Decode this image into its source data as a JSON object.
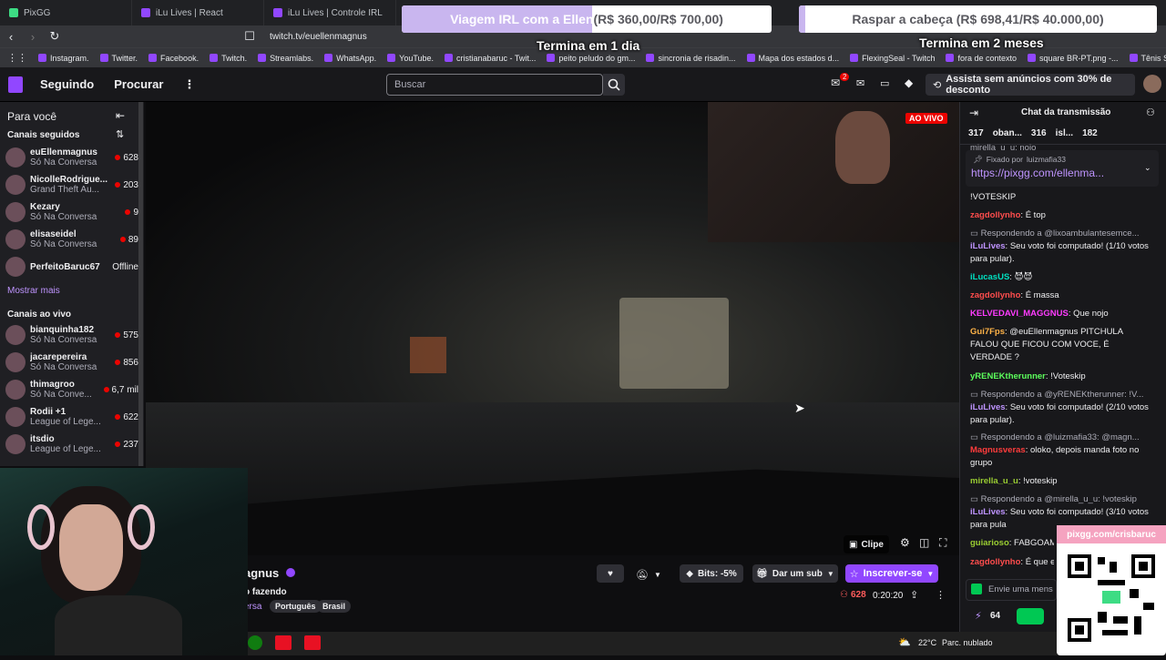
{
  "browser": {
    "tabs": [
      {
        "label": "PixGG"
      },
      {
        "label": "iLu Lives | React"
      },
      {
        "label": "iLu Lives | Controle IRL"
      }
    ],
    "url": "twitch.tv/euellenmagnus",
    "bookmarks": [
      "Instagram.",
      "Twitter.",
      "Facebook.",
      "Twitch.",
      "Streamlabs.",
      "WhatsApp.",
      "YouTube.",
      "cristianabaruc - Twit...",
      "peito peludo do gm...",
      "sincronia de risadin...",
      "Mapa dos estados d...",
      "FlexingSeal - Twitch",
      "fora de contexto",
      "square BR-PT.png -...",
      "Tênis Samba OG -..."
    ]
  },
  "goals": [
    {
      "label_a": "Viagem IRL com a Ellen",
      "label_b": " (R$ 360,00/R$ 700,00)",
      "sub": "Termina em 1 dia",
      "progress": 0.514
    },
    {
      "label": "Raspar a cabeça (R$ 698,41/R$ 40.000,00)",
      "sub": "Termina em 2 meses",
      "progress": 0.017
    }
  ],
  "topnav": {
    "following": "Seguindo",
    "browse": "Procurar",
    "search_placeholder": "Buscar",
    "notif_count": "2",
    "promo": "Assista sem anúncios com 30% de desconto"
  },
  "sidebar": {
    "title": "Para você",
    "followed_header": "Canais seguidos",
    "followed": [
      {
        "name": "euEllenmagnus",
        "game": "Só Na Conversa",
        "viewers": "628"
      },
      {
        "name": "NicolleRodrigue...",
        "game": "Grand Theft Au...",
        "viewers": "203"
      },
      {
        "name": "Kezary",
        "game": "Só Na Conversa",
        "viewers": "9"
      },
      {
        "name": "elisaseidel",
        "game": "Só Na Conversa",
        "viewers": "89"
      },
      {
        "name": "PerfeitoBaruc67",
        "game": "",
        "viewers": "Offline"
      }
    ],
    "show_more": "Mostrar mais",
    "live_header": "Canais ao vivo",
    "live": [
      {
        "name": "bianquinha182",
        "game": "Só Na Conversa",
        "viewers": "575"
      },
      {
        "name": "jacarepereira",
        "game": "Só Na Conversa",
        "viewers": "856"
      },
      {
        "name": "thimagroo",
        "game": "Só Na Conve...",
        "viewers": "6,7 mil"
      },
      {
        "name": "Rodii +1",
        "game": "League of Lege...",
        "viewers": "622"
      },
      {
        "name": "itsdio",
        "game": "League of Lege...",
        "viewers": "237"
      }
    ]
  },
  "video": {
    "live_badge": "AO VIVO",
    "clip": "Clipe"
  },
  "channel": {
    "name_partial": "agnus",
    "title_partial": "o fazendo",
    "category_partial": "ersa",
    "tags": [
      "Português",
      "Brasil"
    ],
    "bits": "Bits: -5%",
    "gift": "Dar um sub",
    "subscribe": "Inscrever-se",
    "viewers": "628",
    "uptime": "0:20:20"
  },
  "chat": {
    "title": "Chat da transmissão",
    "leaders": [
      {
        "value": "317"
      },
      {
        "value": "oban..."
      },
      {
        "value": "316"
      },
      {
        "value": "isl..."
      },
      {
        "value": "182"
      }
    ],
    "pinned_by": "Fixado por",
    "pinned_user": "luizmafia33",
    "pinned_link": "https://pixgg.com/ellenma...",
    "top_cut": "mirella_u_u: nojo",
    "messages": [
      {
        "type": "text",
        "body": "!VOTESKIP"
      },
      {
        "type": "msg",
        "user": "zagdollynho",
        "color": "#ff4d4d",
        "text": ": É top"
      },
      {
        "type": "reply",
        "text": "Respondendo a @lixoambulantesemce..."
      },
      {
        "type": "msg",
        "user": "iLuLives",
        "color": "#bf94ff",
        "text": ": Seu voto foi computado! (1/10 votos para pular)."
      },
      {
        "type": "msg",
        "user": "iLucasUS",
        "color": "#00e0c0",
        "text": ": 😈😈"
      },
      {
        "type": "msg",
        "user": "zagdollynho",
        "color": "#ff4d4d",
        "text": ": É massa"
      },
      {
        "type": "msg",
        "user": "KELVEDAVI_MAGGNUS",
        "color": "#ff3cff",
        "text": ": Que nojo"
      },
      {
        "type": "msg",
        "user": "Gui7Fps",
        "color": "#ffb347",
        "text": ": @euEllenmagnus PITCHULA FALOU QUE FICOU COM VOCE, É VERDADE ?"
      },
      {
        "type": "msg",
        "user": "yRENEKtherunner",
        "color": "#5cff5c",
        "text": ": !Voteskip"
      },
      {
        "type": "reply",
        "text": "Respondendo a @yRENEKtherunner: !V..."
      },
      {
        "type": "msg",
        "user": "iLuLives",
        "color": "#bf94ff",
        "text": ": Seu voto foi computado! (2/10 votos para pular)."
      },
      {
        "type": "reply",
        "text": "Respondendo a @luizmafia33: @magn..."
      },
      {
        "type": "msg",
        "user": "Magnusveras",
        "color": "#ff3c3c",
        "text": ": oloko, depois manda foto no grupo"
      },
      {
        "type": "msg",
        "user": "mirella_u_u",
        "color": "#9acd32",
        "text": ": !voteskip"
      },
      {
        "type": "reply",
        "text": "Respondendo a @mirella_u_u: !voteskip"
      },
      {
        "type": "msg",
        "user": "iLuLives",
        "color": "#bf94ff",
        "text": ": Seu voto foi computado! (3/10 votos para pula"
      },
      {
        "type": "msg",
        "user": "guiarioso",
        "color": "#9acd32",
        "text": ": FABGOAM"
      },
      {
        "type": "msg",
        "user": "zagdollynho",
        "color": "#ff4d4d",
        "text": ": É que e"
      }
    ],
    "input_placeholder": "Envie uma mens",
    "points": "64"
  },
  "qr_overlay": {
    "label": "pixgg.com/crisbaruc"
  },
  "taskbar": {
    "temp": "22°C",
    "weather": "Parc. nublado"
  }
}
